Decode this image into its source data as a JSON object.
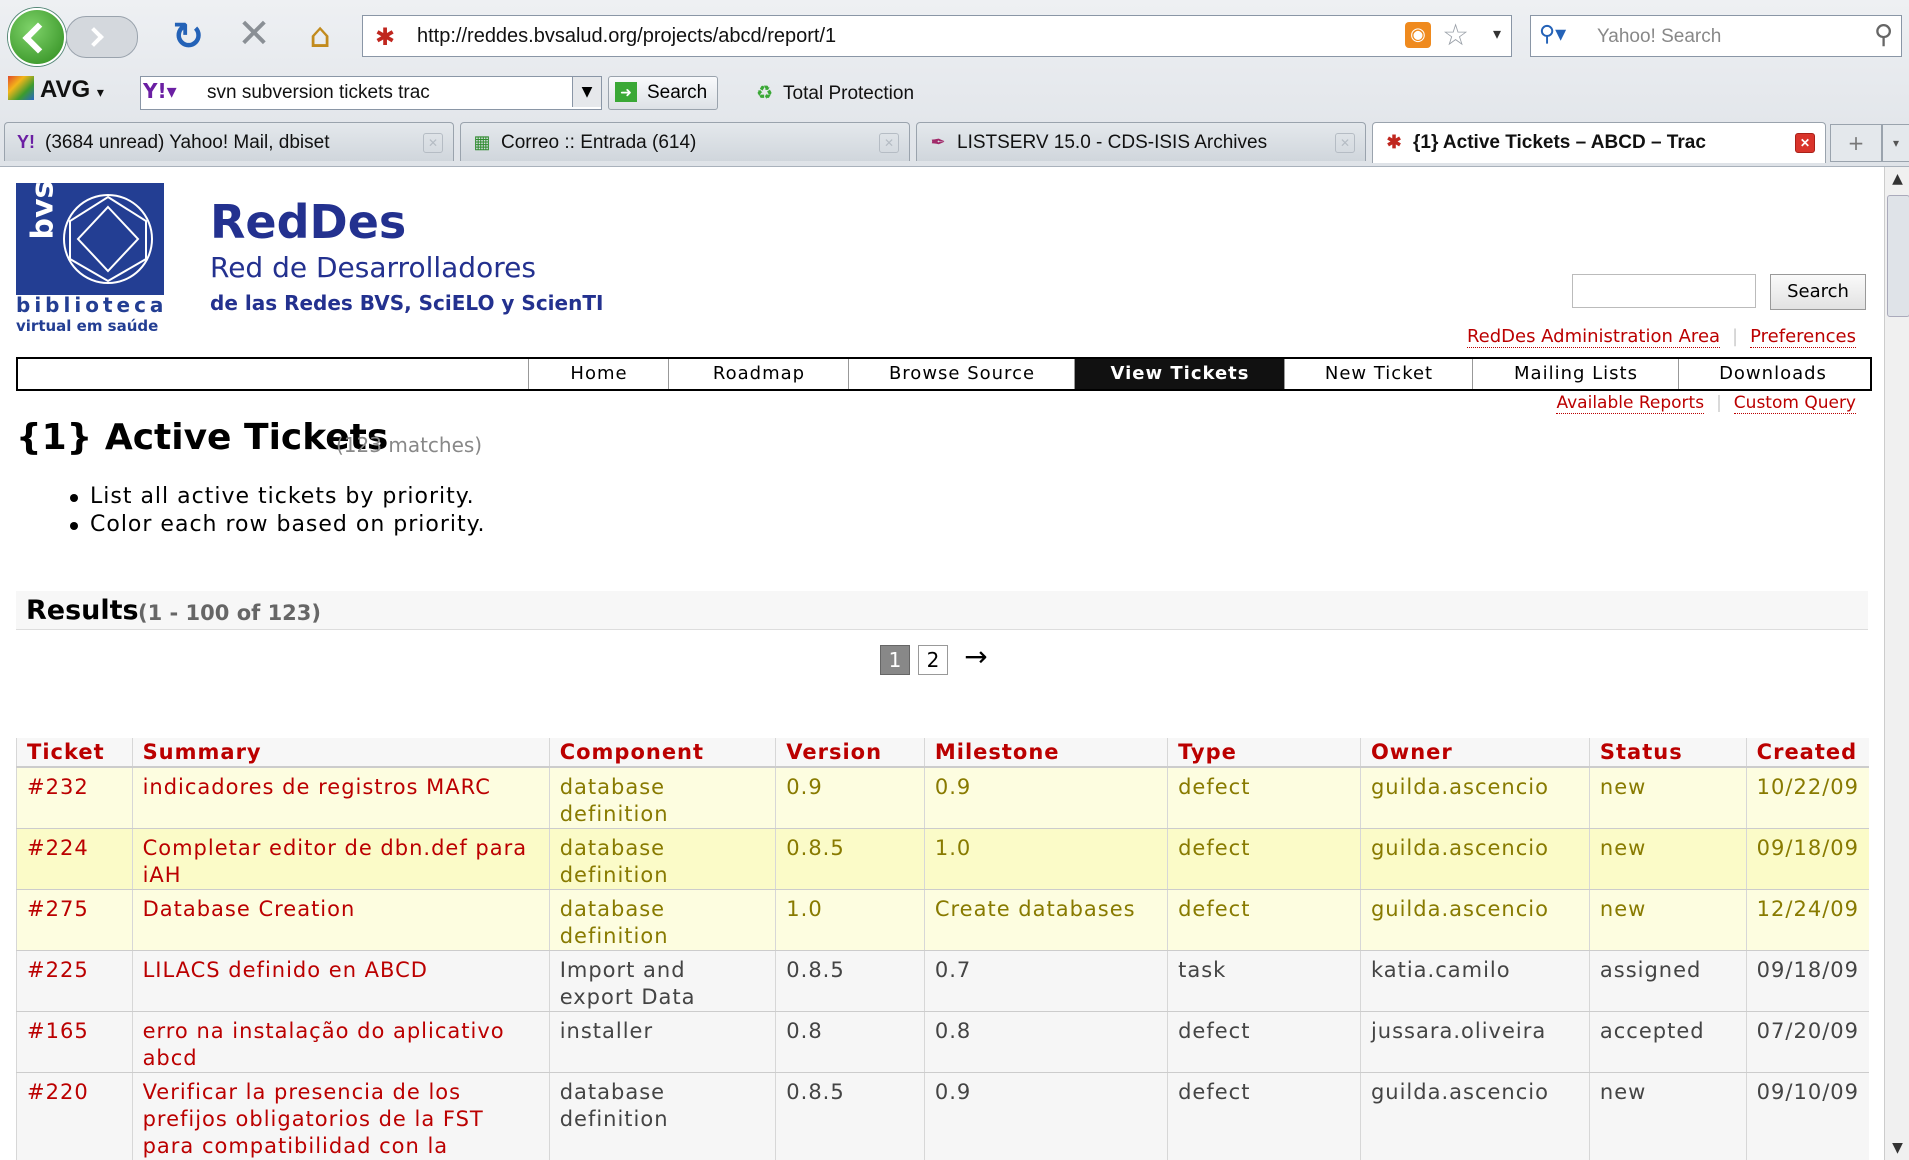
{
  "browser": {
    "url": "http://reddes.bvsalud.org/projects/abcd/report/1",
    "search_placeholder": "Yahoo! Search",
    "toolbar": {
      "avg_label": "AVG",
      "yahoo_query": "svn subversion tickets trac",
      "search_label": "Search",
      "total_protection": "Total Protection"
    },
    "tabs": [
      {
        "title": "(3684 unread) Yahoo! Mail, dbiset",
        "icon": "yahoo-icon"
      },
      {
        "title": "Correo :: Entrada (614)",
        "icon": "mail-icon"
      },
      {
        "title": "LISTSERV 15.0 - CDS-ISIS Archives",
        "icon": "feather-icon"
      },
      {
        "title": "{1} Active Tickets – ABCD – Trac",
        "icon": "trac-icon",
        "active": true
      }
    ]
  },
  "site": {
    "logo_text1": "biblioteca",
    "logo_text2": "virtual em saúde",
    "logo_mark": "bvs",
    "title": "RedDes",
    "subtitle1": "Red de Desarrolladores",
    "subtitle2": "de las Redes BVS, SciELO y ScienTI",
    "search_button": "Search",
    "metanav": [
      "RedDes Administration Area",
      "Preferences"
    ],
    "mainnav": [
      "Home",
      "Roadmap",
      "Browse Source",
      "View Tickets",
      "New Ticket",
      "Mailing Lists",
      "Downloads"
    ],
    "mainnav_active": "View Tickets",
    "ctxnav": [
      "Available Reports",
      "Custom Query"
    ]
  },
  "report": {
    "title": "{1} Active Tickets",
    "matches": "(123 matches)",
    "description": [
      "List all active tickets by priority.",
      "Color each row based on priority."
    ],
    "results_heading": "Results",
    "results_range": "(1 - 100 of 123)",
    "pages": [
      "1",
      "2"
    ],
    "current_page": "1",
    "next_arrow": "→",
    "columns": [
      "Ticket",
      "Summary",
      "Component",
      "Version",
      "Milestone",
      "Type",
      "Owner",
      "Status",
      "Created"
    ],
    "rows": [
      {
        "ticket": "#232",
        "summary": "indicadores de registros MARC",
        "component": "database definition",
        "version": "0.9",
        "milestone": "0.9",
        "type": "defect",
        "owner": "guilda.ascencio",
        "status": "new",
        "created": "10/22/09",
        "priority_class": "p1"
      },
      {
        "ticket": "#224",
        "summary": "Completar editor de dbn.def para iAH",
        "component": "database definition",
        "version": "0.8.5",
        "milestone": "1.0",
        "type": "defect",
        "owner": "guilda.ascencio",
        "status": "new",
        "created": "09/18/09",
        "priority_class": "p2"
      },
      {
        "ticket": "#275",
        "summary": "Database Creation",
        "component": "database definition",
        "version": "1.0",
        "milestone": "Create databases",
        "type": "defect",
        "owner": "guilda.ascencio",
        "status": "new",
        "created": "12/24/09",
        "priority_class": "p1"
      },
      {
        "ticket": "#225",
        "summary": "LILACS definido en ABCD",
        "component": "Import and export Data",
        "version": "0.8.5",
        "milestone": "0.7",
        "type": "task",
        "owner": "katia.camilo",
        "status": "assigned",
        "created": "09/18/09",
        "priority_class": "p3"
      },
      {
        "ticket": "#165",
        "summary": "erro na instalação do aplicativo abcd",
        "component": "installer",
        "version": "0.8",
        "milestone": "0.8",
        "type": "defect",
        "owner": "jussara.oliveira",
        "status": "accepted",
        "created": "07/20/09",
        "priority_class": "p3"
      },
      {
        "ticket": "#220",
        "summary": "Verificar la presencia de los prefijos obligatorios de la FST para compatibilidad con la",
        "component": "database definition",
        "version": "0.8.5",
        "milestone": "0.9",
        "type": "defect",
        "owner": "guilda.ascencio",
        "status": "new",
        "created": "09/10/09",
        "priority_class": "p3"
      }
    ]
  }
}
